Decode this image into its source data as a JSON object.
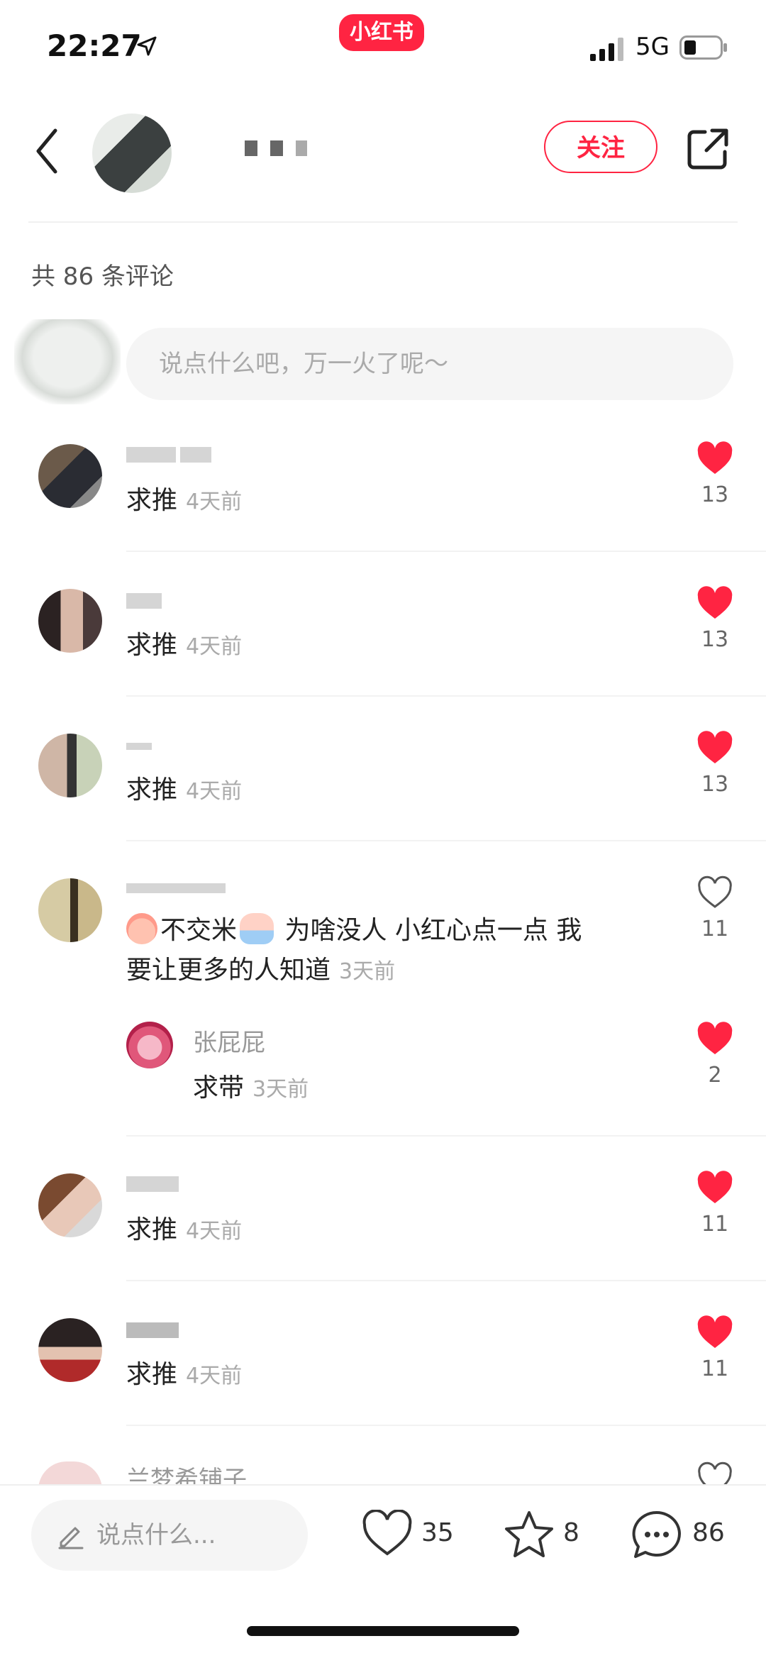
{
  "status_bar": {
    "time": "22:27",
    "network": "5G",
    "app_badge": "小红书"
  },
  "header": {
    "follow_label": "关注"
  },
  "comments_header": {
    "count_text": "共 86 条评论"
  },
  "comment_input": {
    "placeholder": "说点什么吧，万一火了呢～"
  },
  "comments": [
    {
      "text": "求推",
      "time": "4天前",
      "likes": "13",
      "liked": true
    },
    {
      "text": "求推",
      "time": "4天前",
      "likes": "13",
      "liked": true
    },
    {
      "text": "求推",
      "time": "4天前",
      "likes": "13",
      "liked": true
    },
    {
      "text_a": "不交米",
      "text_b": " 为啥没人  小红心点一点  我",
      "text_c": "要让更多的人知道",
      "time": "3天前",
      "likes": "11",
      "liked": false,
      "reply": {
        "name": "张屁屁",
        "text": "求带",
        "time": "3天前",
        "likes": "2",
        "liked": true
      }
    },
    {
      "text": "求推",
      "time": "4天前",
      "likes": "11",
      "liked": true
    },
    {
      "text": "求推",
      "time": "4天前",
      "likes": "11",
      "liked": true
    },
    {
      "name": "兰梦希铺子"
    }
  ],
  "bottom_bar": {
    "input_placeholder": "说点什么...",
    "likes": "35",
    "collects": "8",
    "comments": "86"
  },
  "colors": {
    "accent": "#ff2442",
    "heart": "#ff2442"
  }
}
